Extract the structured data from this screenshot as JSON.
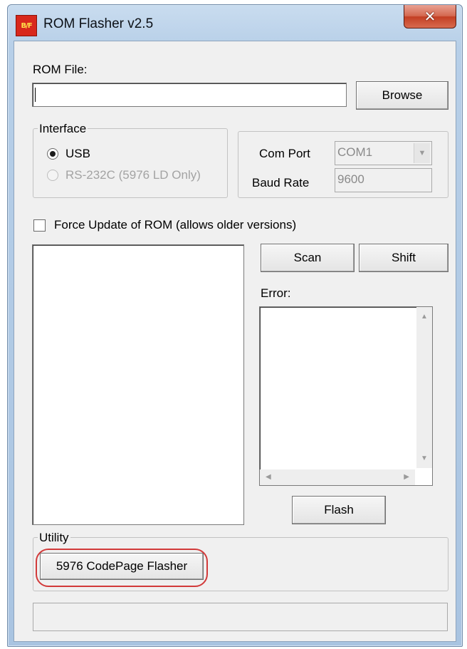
{
  "window": {
    "title": "ROM Flasher v2.5",
    "app_icon_text": "B/F",
    "close_glyph": "✕"
  },
  "rom_file": {
    "label": "ROM File:",
    "value": "",
    "browse_label": "Browse"
  },
  "interface": {
    "group_title": "Interface",
    "usb_label": "USB",
    "usb_selected": true,
    "rs232_label": "RS-232C (5976 LD Only)",
    "rs232_enabled": false
  },
  "comport": {
    "label": "Com Port",
    "value": "COM1",
    "baud_label": "Baud Rate",
    "baud_value": "9600"
  },
  "force_update": {
    "label": "Force Update of ROM (allows older versions)",
    "checked": false
  },
  "actions": {
    "scan_label": "Scan",
    "shift_label": "Shift",
    "flash_label": "Flash"
  },
  "error": {
    "label": "Error:",
    "text": ""
  },
  "utility": {
    "group_title": "Utility",
    "codepage_button_label": "5976 CodePage Flasher"
  },
  "status": {
    "text": ""
  },
  "colors": {
    "highlight": "#d23a3a",
    "titlebar": "#b7cfe8",
    "close_button": "#c33f24"
  }
}
